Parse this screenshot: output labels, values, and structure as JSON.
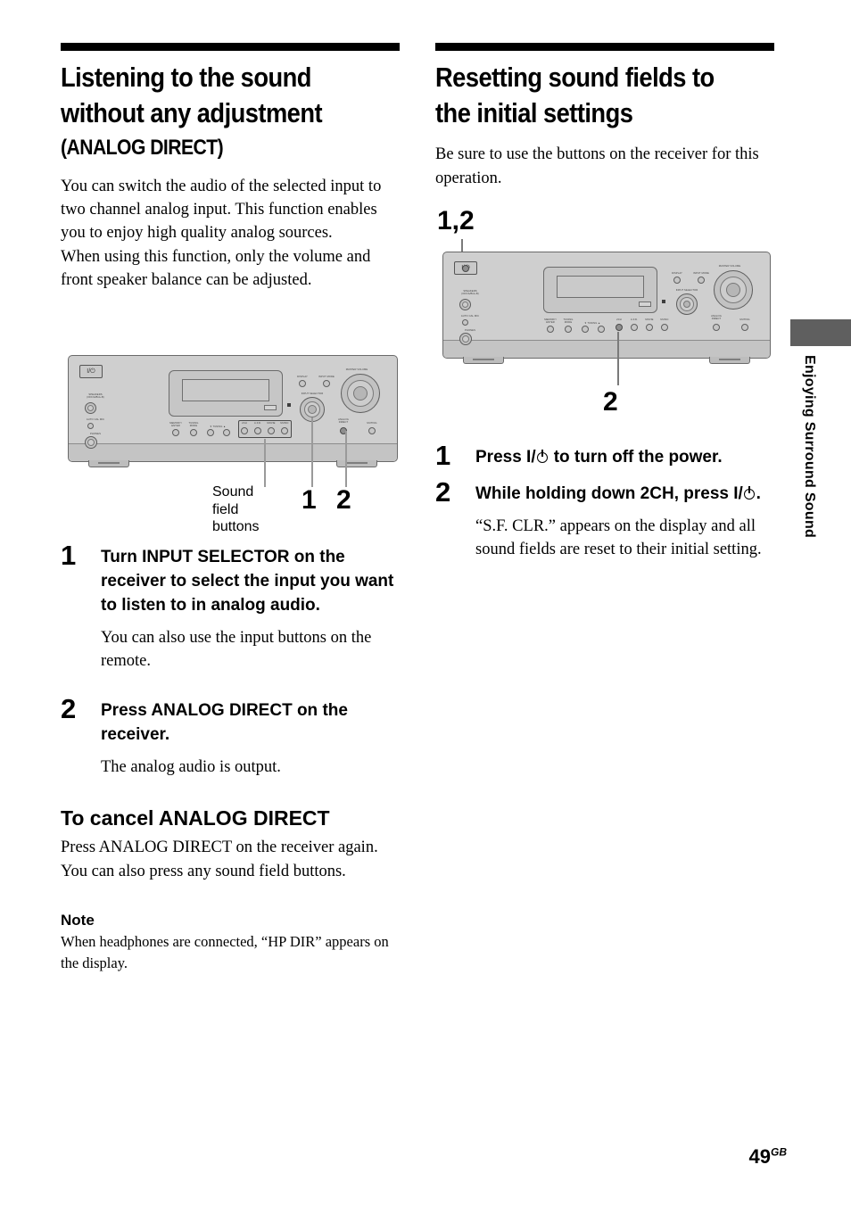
{
  "page": {
    "number": "49",
    "region_code": "GB",
    "side_tab": "Enjoying Surround Sound"
  },
  "left_column": {
    "title_line1": "Listening to the sound",
    "title_line2": "without any adjustment",
    "title_sub": "(ANALOG DIRECT)",
    "intro": "You can switch the audio of the selected input to two channel analog input. This function enables you to enjoy high quality analog sources.",
    "intro2": "When using this function, only the volume and front speaker balance can be adjusted.",
    "diagram": {
      "callout_label": "Sound field buttons",
      "callout_1": "1",
      "callout_2": "2",
      "panel_labels": {
        "power": "I/⏻",
        "speakers": "SPEAKERS (OFF/A/B/A+B)",
        "auto_cal_mic": "AUTO CAL MIC",
        "phones": "PHONES",
        "memory_enter": "MEMORY/ ENTER",
        "tuning_mode": "TUNING MODE",
        "tuning": "TUNING",
        "display": "DISPLAY",
        "input_mode": "INPUT MODE",
        "input_selector": "INPUT SELECTOR",
        "master_volume": "MASTER VOLUME",
        "analog_direct": "ANALOG DIRECT",
        "muting": "MUTING",
        "sound_field_buttons": [
          "2CH",
          "A.F.D.",
          "MOVIE",
          "MUSIC"
        ]
      }
    },
    "steps": [
      {
        "num": "1",
        "head": "Turn INPUT SELECTOR on the receiver to select the input you want to listen to in analog audio.",
        "desc": "You can also use the input buttons on the remote."
      },
      {
        "num": "2",
        "head": "Press ANALOG DIRECT on the receiver.",
        "desc": "The analog audio is output."
      }
    ],
    "cancel_head": "To cancel ANALOG DIRECT",
    "cancel_body1": "Press ANALOG DIRECT on the receiver again.",
    "cancel_body2": "You can also press any sound field buttons.",
    "note_head": "Note",
    "note_body": "When headphones are connected, “HP DIR” appears on the display."
  },
  "right_column": {
    "title_line1": "Resetting sound fields to",
    "title_line2": "the initial settings",
    "intro": "Be sure to use the buttons on the receiver for this operation.",
    "diagram": {
      "callout_top": "1,2",
      "callout_bottom": "2"
    },
    "steps": [
      {
        "num": "1",
        "head_before": "Press ",
        "head_power": "I/⏻",
        "head_after": " to turn off the power."
      },
      {
        "num": "2",
        "head_before": "While holding down 2CH, press ",
        "head_power": "I/⏻",
        "head_after": "."
      }
    ],
    "result": "“S.F. CLR.” appears on the display and all sound fields are reset to their initial setting."
  }
}
